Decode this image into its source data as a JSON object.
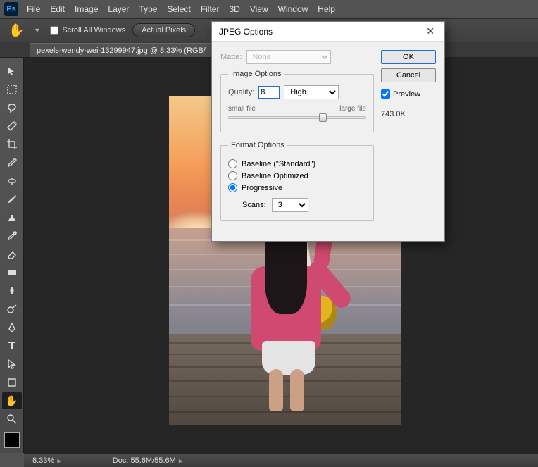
{
  "menus": [
    "File",
    "Edit",
    "Image",
    "Layer",
    "Type",
    "Select",
    "Filter",
    "3D",
    "View",
    "Window",
    "Help"
  ],
  "optbar": {
    "scroll_all": "Scroll All Windows",
    "actual_pixels": "Actual Pixels"
  },
  "doc_tab": "pexels-wendy-wei-13299947.jpg @ 8.33% (RGB/",
  "status": {
    "zoom": "8.33%",
    "doc": "Doc: 55.6M/55.6M"
  },
  "dialog": {
    "title": "JPEG Options",
    "ok": "OK",
    "cancel": "Cancel",
    "preview_label": "Preview",
    "preview_checked": true,
    "filesize": "743.0K",
    "matte_label": "Matte:",
    "matte_value": "None",
    "image_options_legend": "Image Options",
    "quality_label": "Quality:",
    "quality_value": "8",
    "quality_preset": "High",
    "slider_small": "small file",
    "slider_large": "large file",
    "format_legend": "Format Options",
    "fmt_baseline_std": "Baseline (\"Standard\")",
    "fmt_baseline_opt": "Baseline Optimized",
    "fmt_progressive": "Progressive",
    "fmt_selected": "progressive",
    "scans_label": "Scans:",
    "scans_value": "3"
  },
  "tool_names": [
    "move",
    "marquee",
    "lasso",
    "magic-wand",
    "crop",
    "eyedropper",
    "heal",
    "brush",
    "stamp",
    "history-brush",
    "eraser",
    "gradient",
    "blur",
    "dodge",
    "pen",
    "type",
    "path-select",
    "rectangle",
    "hand",
    "zoom"
  ]
}
